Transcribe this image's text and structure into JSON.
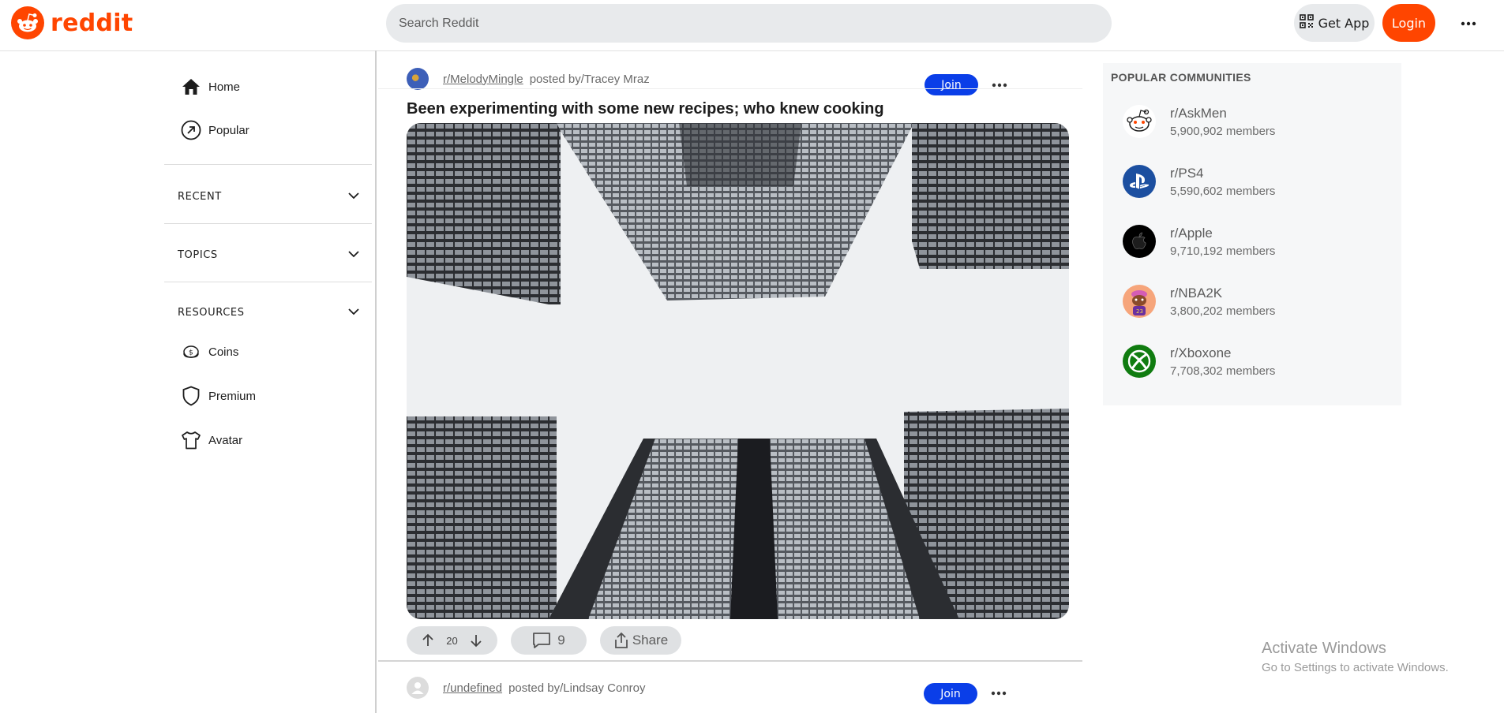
{
  "header": {
    "logo_text": "reddit",
    "search_placeholder": "Search Reddit",
    "get_app_label": "Get App",
    "login_label": "Login"
  },
  "sidebar": {
    "items": [
      {
        "label": "Home",
        "icon": "home-icon"
      },
      {
        "label": "Popular",
        "icon": "popular-icon"
      }
    ],
    "sections": [
      "RECENT",
      "TOPICS",
      "RESOURCES"
    ],
    "resources": [
      {
        "label": "Coins",
        "icon": "coins-icon"
      },
      {
        "label": "Premium",
        "icon": "shield-icon"
      },
      {
        "label": "Avatar",
        "icon": "shirt-icon"
      }
    ]
  },
  "posts": [
    {
      "subreddit": "r/MelodyMingle",
      "posted_by": "posted by/Tracey Mraz",
      "join_label": "Join",
      "title": "Been experimenting with some new recipes; who knew cooking",
      "upvotes": "20",
      "comments": "9",
      "share_label": "Share"
    },
    {
      "subreddit": "r/undefined",
      "posted_by": "posted by/Lindsay Conroy",
      "join_label": "Join"
    }
  ],
  "communities": {
    "title": "POPULAR COMMUNITIES",
    "items": [
      {
        "name": "r/AskMen",
        "members": "5,900,902 members",
        "icon": "askmen-icon"
      },
      {
        "name": "r/PS4",
        "members": "5,590,602 members",
        "icon": "playstation-icon"
      },
      {
        "name": "r/Apple",
        "members": "9,710,192 members",
        "icon": "apple-icon"
      },
      {
        "name": "r/NBA2K",
        "members": "3,800,202 members",
        "icon": "nba2k-icon"
      },
      {
        "name": "r/Xboxone",
        "members": "7,708,302 members",
        "icon": "xbox-icon"
      }
    ]
  },
  "watermark": {
    "line1": "Activate Windows",
    "line2": "Go to Settings to activate Windows."
  },
  "colors": {
    "brand": "#ff4500",
    "join": "#0a3ee8"
  }
}
